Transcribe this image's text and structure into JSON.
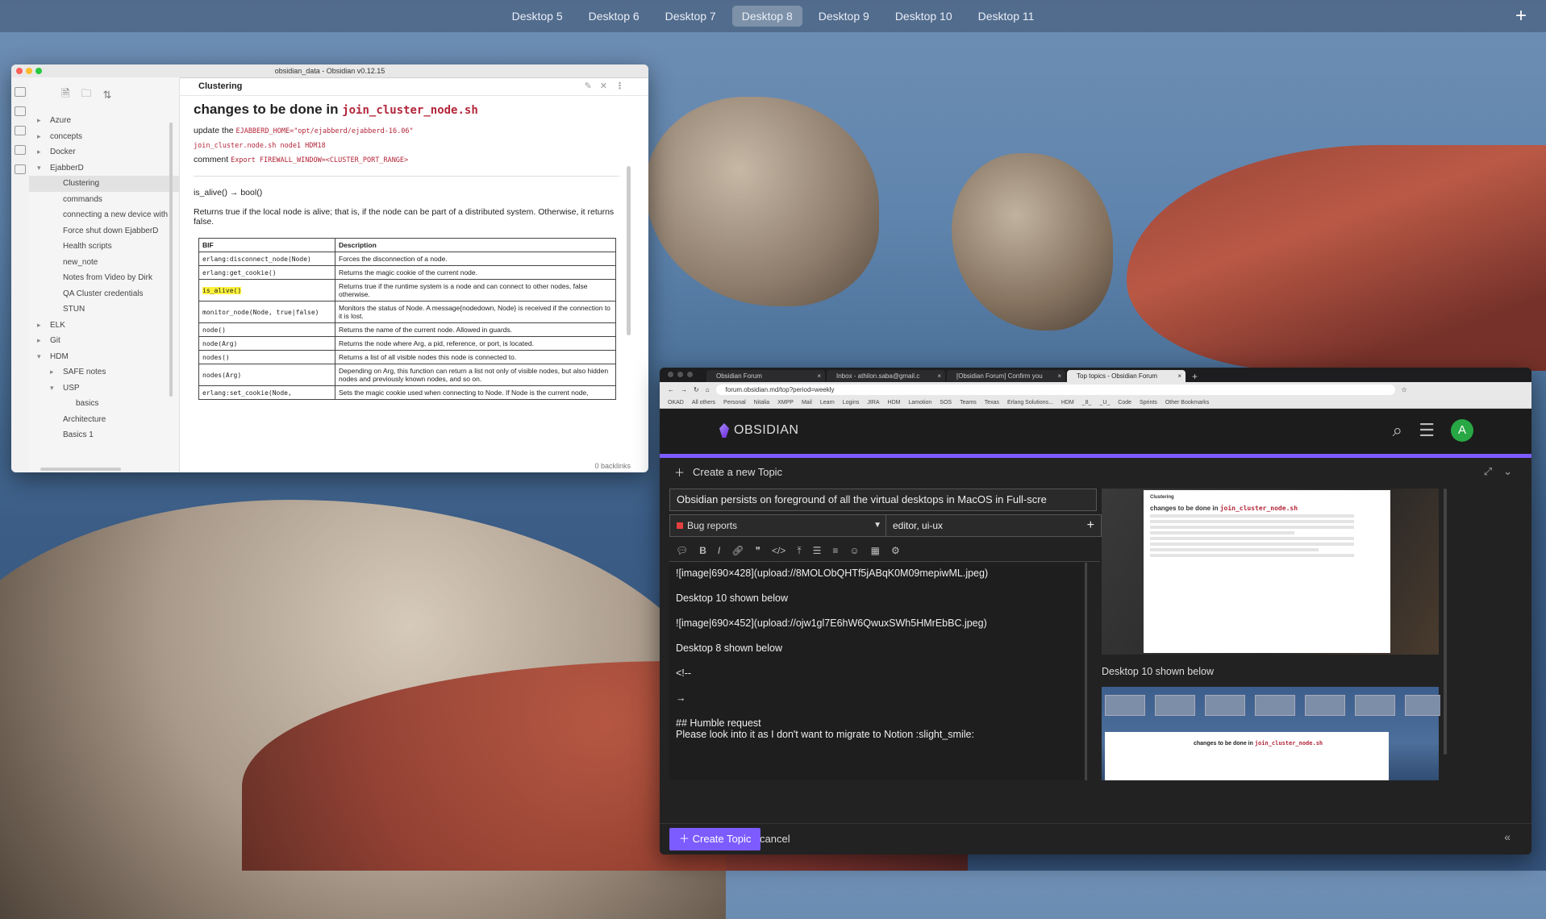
{
  "desktops": [
    "Desktop 5",
    "Desktop 6",
    "Desktop 7",
    "Desktop 8",
    "Desktop 9",
    "Desktop 10",
    "Desktop 11"
  ],
  "active_desktop": "Desktop 8",
  "add_desktop": "+",
  "obsidian": {
    "window_title": "obsidian_data - Obsidian v0.12.15",
    "tab_title": "Clustering",
    "sidebar": [
      {
        "label": "Azure",
        "kind": "folder"
      },
      {
        "label": "concepts",
        "kind": "folder"
      },
      {
        "label": "Docker",
        "kind": "folder"
      },
      {
        "label": "EjabberD",
        "kind": "open"
      },
      {
        "label": "Clustering",
        "kind": "file1",
        "selected": true
      },
      {
        "label": "commands",
        "kind": "file1"
      },
      {
        "label": "connecting a new device with",
        "kind": "file1"
      },
      {
        "label": "Force shut down EjabberD",
        "kind": "file1"
      },
      {
        "label": "Health scripts",
        "kind": "file1"
      },
      {
        "label": "new_note",
        "kind": "file1"
      },
      {
        "label": "Notes from Video by Dirk",
        "kind": "file1"
      },
      {
        "label": "QA Cluster credentials",
        "kind": "file1"
      },
      {
        "label": "STUN",
        "kind": "file1"
      },
      {
        "label": "ELK",
        "kind": "folder"
      },
      {
        "label": "Git",
        "kind": "folder"
      },
      {
        "label": "HDM",
        "kind": "open"
      },
      {
        "label": "SAFE notes",
        "kind": "folder1"
      },
      {
        "label": "USP",
        "kind": "open1"
      },
      {
        "label": "basics",
        "kind": "file2"
      },
      {
        "label": "Architecture",
        "kind": "file1"
      },
      {
        "label": "Basics 1",
        "kind": "file1"
      }
    ],
    "heading_prefix": "changes to be done in ",
    "heading_code": "join_cluster_node.sh",
    "update_label": "update the ",
    "update_code": "EJABBERD_HOME=\"opt/ejabberd/ejabberd-16.06\"",
    "cmd_line": "join_cluster.node.sh node1 HDM18",
    "comment_label": "comment ",
    "comment_code": "Export FIREWALL_WINDOW=<CLUSTER_PORT_RANGE>",
    "fn_sig": "is_alive() → bool()",
    "desc": "Returns true if the local node is alive; that is, if the node can be part of a distributed system. Otherwise, it returns false.",
    "table_headers": [
      "BIF",
      "Description"
    ],
    "table_rows": [
      [
        "erlang:disconnect_node(Node)",
        "Forces the disconnection of a node."
      ],
      [
        "erlang:get_cookie()",
        "Returns the magic cookie of the current node."
      ],
      [
        "is_alive()",
        "Returns true if the runtime system is a node and can connect to other nodes, false otherwise."
      ],
      [
        "monitor_node(Node, true|false)",
        "Monitors the status of Node. A message{nodedown, Node} is received if the connection to it is lost."
      ],
      [
        "node()",
        "Returns the name of the current node. Allowed in guards."
      ],
      [
        "node(Arg)",
        "Returns the node where Arg, a pid, reference, or port, is located."
      ],
      [
        "nodes()",
        "Returns a list of all visible nodes this node is connected to."
      ],
      [
        "nodes(Arg)",
        "Depending on Arg, this function can return a list not only of visible nodes, but also hidden nodes and previously known nodes, and so on."
      ],
      [
        "erlang:set_cookie(Node,",
        "Sets the magic cookie used when connecting to Node. If Node is the current node,"
      ]
    ],
    "backlinks": "0 backlinks"
  },
  "browser": {
    "tabs": [
      "Obsidian Forum",
      "Inbox - athilon.saba@gmail.c",
      "[Obsidian Forum] Confirm you",
      "Top topics - Obsidian Forum"
    ],
    "active_tab": 3,
    "new_tab": "+",
    "url": "forum.obsidian.md/top?period=weekly",
    "bookmarks": [
      "OKAD",
      "All others",
      "Personal",
      "Nitalia",
      "XMPP",
      "Mail",
      "Learn",
      "Logins",
      "JIRA",
      "HDM",
      "Lamotion",
      "SOS",
      "Teams",
      "Texas",
      "Erlang Solutions...",
      "HDM",
      "_8_",
      "_U_",
      "Code",
      "Sprints",
      "Other Bookmarks"
    ],
    "site_name": "OBSIDIAN",
    "avatar_letter": "A",
    "composer": {
      "header": "Create a new Topic",
      "title_value": "Obsidian persists on foreground of all the virtual desktops in MacOS in Full-scre",
      "category": "Bug reports",
      "tags": "editor, ui-ux",
      "editor_lines": [
        "![image|690×428](upload://8MOLObQHTf5jABqK0M09mepiwML.jpeg)",
        "Desktop 10 shown below",
        "![image|690×452](upload://ojw1gl7E6hW6QwuxSWh5HMrEbBC.jpeg)",
        "Desktop 8 shown below",
        "<!--",
        "→",
        "## Humble request",
        "Please look into it as I don't want to migrate to Notion :slight_smile:"
      ],
      "preview_caption": "Desktop 10 shown below",
      "preview_heading_prefix": "changes to be done in ",
      "preview_heading_code": "join_cluster_node.sh",
      "preview_tab": "Clustering",
      "create_button": "Create Topic",
      "cancel": "cancel"
    }
  },
  "colors": {
    "accent": "#7c5cff",
    "code_red": "#b3263a",
    "highlight": "#fff23a",
    "category_square": "#e43f3f",
    "avatar_bg": "#28a745"
  }
}
